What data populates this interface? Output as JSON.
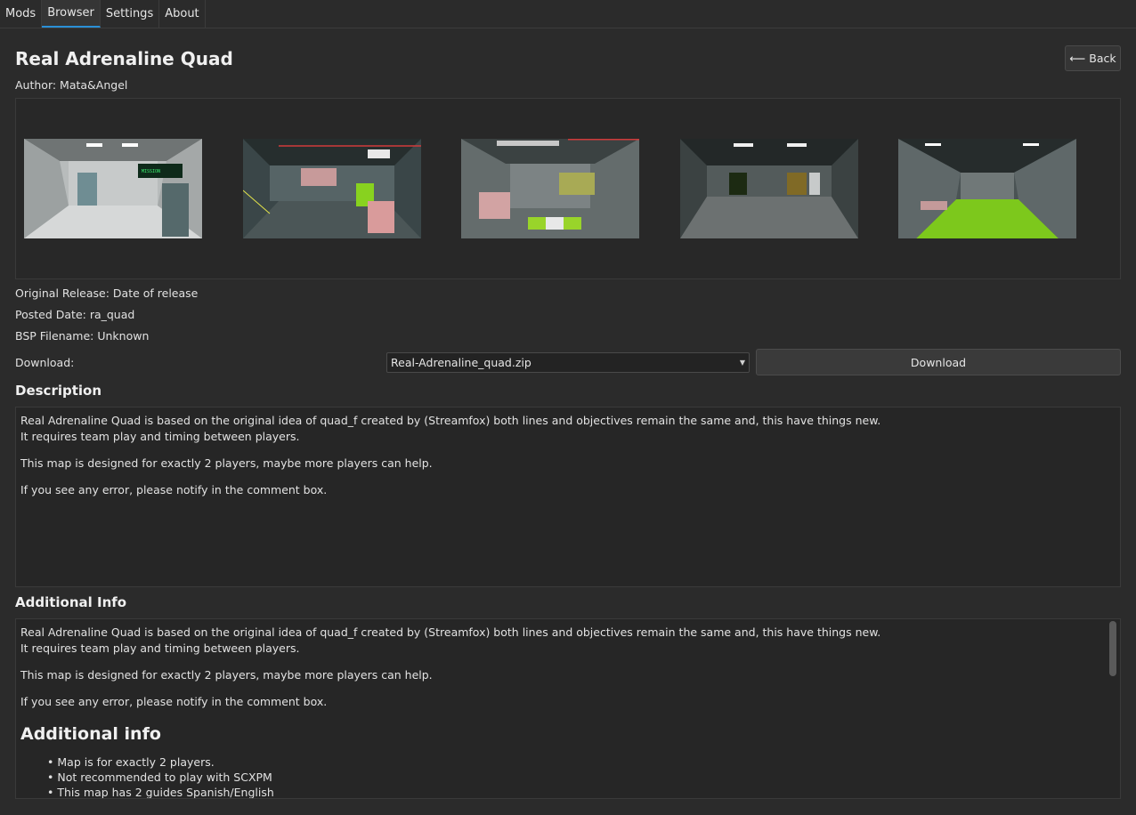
{
  "tabs": [
    {
      "label": "Mods"
    },
    {
      "label": "Browser"
    },
    {
      "label": "Settings"
    },
    {
      "label": "About"
    }
  ],
  "active_tab": "Browser",
  "accent_color": "#2a8fd6",
  "header": {
    "title": "Real Adrenaline Quad",
    "back_label": "Back",
    "back_icon": "long-left-arrow-icon",
    "author": "Author: Mata&Angel"
  },
  "gallery": {
    "count": 5
  },
  "meta": {
    "original_release": "Original Release: Date of release",
    "posted_date": "Posted Date: ra_quad",
    "bsp_filename": "BSP Filename: Unknown"
  },
  "download": {
    "label": "Download:",
    "selected_file": "Real-Adrenaline_quad.zip",
    "button_label": "Download"
  },
  "description": {
    "heading": "Description",
    "line1": "Real Adrenaline Quad is based on the original idea of quad_f created by (Streamfox) both lines and objectives remain the same and, this have things new.",
    "line2": "It requires team play and timing between players.",
    "para2": "This map is designed for exactly 2 players, maybe more players can help.",
    "para3": "If you see any error, please notify in the comment box."
  },
  "additional": {
    "heading": "Additional Info",
    "line1": "Real Adrenaline Quad is based on the original idea of quad_f created by (Streamfox) both lines and objectives remain the same and, this have things new.",
    "line2": "It requires team play and timing between players.",
    "para2": "This map is designed for exactly 2 players, maybe more players can help.",
    "para3": "If you see any error, please notify in the comment box.",
    "subheading": "Additional info",
    "bullets": [
      "Map is for exactly 2 players.",
      "Not recommended to play with SCXPM",
      "This map has 2 guides Spanish/English"
    ]
  }
}
